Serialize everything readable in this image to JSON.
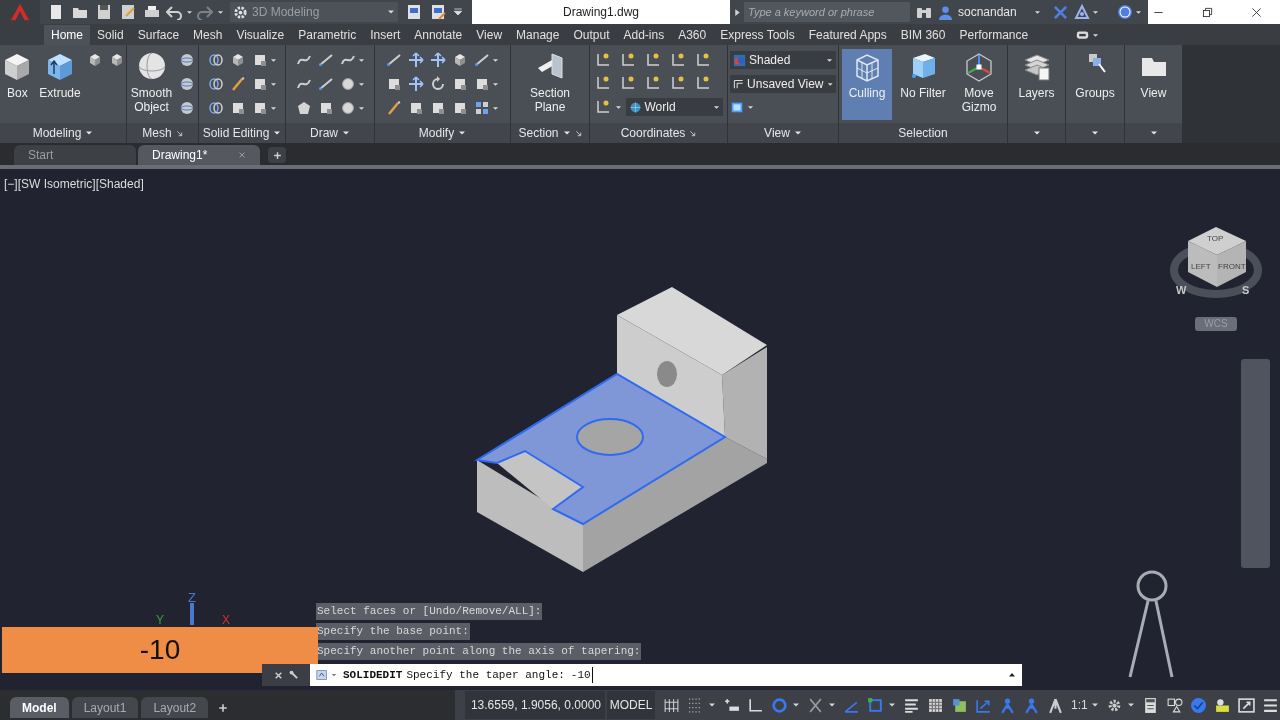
{
  "title_bar": {
    "workspace": "3D Modeling",
    "document_title": "Drawing1.dwg",
    "search_placeholder": "Type a keyword or phrase",
    "user": "socnandan"
  },
  "ribbon_tabs": [
    {
      "label": "Home",
      "selected": true
    },
    {
      "label": "Solid",
      "selected": false
    },
    {
      "label": "Surface",
      "selected": false
    },
    {
      "label": "Mesh",
      "selected": false
    },
    {
      "label": "Visualize",
      "selected": false
    },
    {
      "label": "Parametric",
      "selected": false
    },
    {
      "label": "Insert",
      "selected": false
    },
    {
      "label": "Annotate",
      "selected": false
    },
    {
      "label": "View",
      "selected": false
    },
    {
      "label": "Manage",
      "selected": false
    },
    {
      "label": "Output",
      "selected": false
    },
    {
      "label": "Add-ins",
      "selected": false
    },
    {
      "label": "A360",
      "selected": false
    },
    {
      "label": "Express Tools",
      "selected": false
    },
    {
      "label": "Featured Apps",
      "selected": false
    },
    {
      "label": "BIM 360",
      "selected": false
    },
    {
      "label": "Performance",
      "selected": false
    }
  ],
  "ribbon_panels": [
    {
      "title": "Modeling",
      "buttons": [
        {
          "label": "Box"
        },
        {
          "label": "Extrude"
        }
      ]
    },
    {
      "title": "Mesh",
      "buttons": [
        {
          "label": "Smooth Object"
        }
      ]
    },
    {
      "title": "Solid Editing"
    },
    {
      "title": "Draw"
    },
    {
      "title": "Modify"
    },
    {
      "title": "Section",
      "buttons": [
        {
          "label": "Section Plane"
        }
      ]
    },
    {
      "title": "Coordinates",
      "dropdowns": [
        {
          "value": "World"
        }
      ]
    },
    {
      "title": "View",
      "dropdowns": [
        {
          "value": "Shaded"
        },
        {
          "value": "Unsaved View"
        }
      ]
    },
    {
      "title": "Selection",
      "buttons": [
        {
          "label": "Culling",
          "on": true
        },
        {
          "label": "No Filter",
          "on": false
        },
        {
          "label": "Move Gizmo",
          "on": false
        }
      ]
    },
    {
      "buttons": [
        {
          "label": "Layers"
        }
      ]
    },
    {
      "buttons": [
        {
          "label": "Groups"
        }
      ]
    },
    {
      "buttons": [
        {
          "label": "View"
        }
      ]
    }
  ],
  "file_tabs": [
    {
      "label": "Start",
      "selected": false
    },
    {
      "label": "Drawing1*",
      "selected": true
    }
  ],
  "viewport": {
    "label": "[−][SW Isometric][Shaded]",
    "view_cube": {
      "faces": [
        "TOP",
        "LEFT",
        "FRONT"
      ],
      "compass": [
        "W",
        "S"
      ],
      "ucs": "WCS"
    },
    "axes": [
      "X",
      "Y",
      "Z"
    ]
  },
  "dynamic_input": "-10",
  "command_history": [
    "Select faces or [Undo/Remove/ALL]:",
    "Specify the base point:",
    "Specify another point along the axis of tapering:"
  ],
  "command_line": {
    "command": "SOLIDEDIT",
    "prompt": "Specify the taper angle:",
    "value": "-10"
  },
  "layout_tabs": [
    {
      "label": "Model",
      "selected": true
    },
    {
      "label": "Layout1",
      "selected": false
    },
    {
      "label": "Layout2",
      "selected": false
    }
  ],
  "status_bar": {
    "coordinates": "13.6559, 1.9056, 0.0000",
    "space": "MODEL",
    "scale": "1:1"
  }
}
